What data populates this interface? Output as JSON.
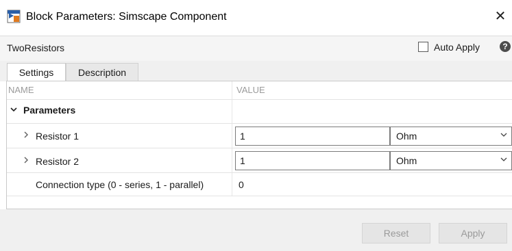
{
  "window": {
    "title": "Block Parameters: Simscape Component",
    "close_glyph": "✕",
    "app_icon": "simulink-block-icon"
  },
  "header": {
    "block_name": "TwoResistors",
    "auto_apply_label": "Auto Apply",
    "auto_apply_checked": false,
    "help_glyph": "?"
  },
  "tabs": [
    {
      "label": "Settings",
      "active": true
    },
    {
      "label": "Description",
      "active": false
    }
  ],
  "table": {
    "columns": {
      "name": "NAME",
      "value": "VALUE"
    },
    "section_label": "Parameters",
    "rows": [
      {
        "label": "Resistor 1",
        "value": "1",
        "unit": "Ohm",
        "expandable": true
      },
      {
        "label": "Resistor 2",
        "value": "1",
        "unit": "Ohm",
        "expandable": true
      },
      {
        "label": "Connection type (0 - series, 1 - parallel)",
        "value": "0",
        "expandable": false
      }
    ]
  },
  "footer": {
    "reset_label": "Reset",
    "apply_label": "Apply"
  },
  "colors": {
    "disabled_button_text": "#9a9a9a",
    "header_text_gray": "#9b9b9b"
  }
}
